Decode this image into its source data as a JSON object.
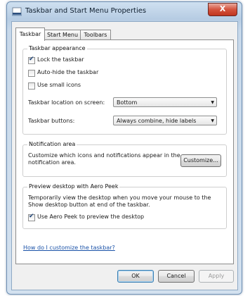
{
  "window": {
    "title": "Taskbar and Start Menu Properties",
    "close_glyph": "X"
  },
  "tabs": [
    {
      "label": "Taskbar",
      "active": true
    },
    {
      "label": "Start Menu",
      "active": false
    },
    {
      "label": "Toolbars",
      "active": false
    }
  ],
  "taskbar_appearance": {
    "title": "Taskbar appearance",
    "lock": {
      "label": "Lock the taskbar",
      "checked": true
    },
    "autohide": {
      "label": "Auto-hide the taskbar",
      "checked": false
    },
    "small_icons": {
      "label": "Use small icons",
      "checked": false
    },
    "location_label": "Taskbar location on screen:",
    "location_value": "Bottom",
    "buttons_label": "Taskbar buttons:",
    "buttons_value": "Always combine, hide labels"
  },
  "notification_area": {
    "title": "Notification area",
    "text_line1": "Customize which icons and notifications appear in the",
    "text_line2": "notification area.",
    "customize_label": "Customize..."
  },
  "aero_peek": {
    "title": "Preview desktop with Aero Peek",
    "text_line1": "Temporarily view the desktop when you move your mouse to the",
    "text_line2": "Show desktop button at end of the taskbar.",
    "use_peek": {
      "label": "Use Aero Peek to preview the desktop",
      "checked": true
    }
  },
  "help_link": "How do I customize the taskbar?",
  "buttons": {
    "ok": "OK",
    "cancel": "Cancel",
    "apply": "Apply"
  },
  "colors": {
    "link": "#1a52a8",
    "close": "#c9452f",
    "title_bar": "#b6cce3"
  },
  "icons": {
    "window_icon": "taskbar-icon",
    "check": "✔",
    "dropdown": "▼"
  }
}
